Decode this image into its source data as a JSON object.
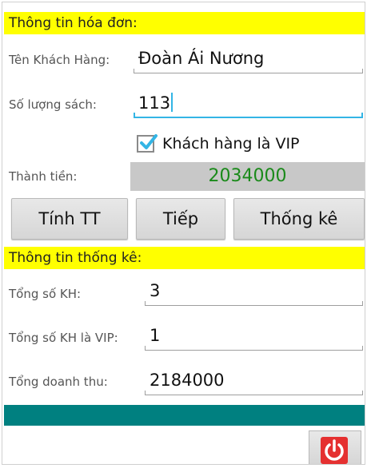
{
  "invoice": {
    "header": "Thông tin hóa đơn:",
    "customer_label": "Tên Khách Hàng:",
    "customer_value": "Đoàn Ái Nương",
    "books_label": "Số lượng sách:",
    "books_value": "113",
    "vip_label": "Khách hàng là VIP",
    "vip_checked": true,
    "total_label": "Thành tiền:",
    "total_value": "2034000"
  },
  "buttons": {
    "calc": "Tính TT",
    "next": "Tiếp",
    "stats": "Thống kê"
  },
  "stats": {
    "header": "Thông tin thống kê:",
    "total_customers_label": "Tổng số KH:",
    "total_customers_value": "3",
    "vip_customers_label": "Tổng số KH là VIP:",
    "vip_customers_value": "1",
    "revenue_label": "Tổng doanh thu:",
    "revenue_value": "2184000"
  },
  "colors": {
    "header_bg": "#ffff00",
    "total_text": "#1a8a1a",
    "focus_accent": "#33b5e5",
    "bottom_bar": "#008080",
    "power_button": "#e53030"
  },
  "icons": {
    "checkbox": "checkmark-icon",
    "exit": "power-icon"
  }
}
